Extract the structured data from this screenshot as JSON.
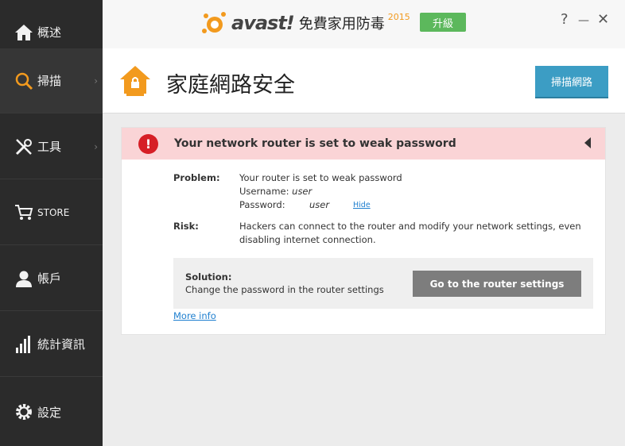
{
  "sidebar": {
    "items": [
      {
        "label": "概述",
        "icon": "home-icon"
      },
      {
        "label": "掃描",
        "icon": "search-icon"
      },
      {
        "label": "工具",
        "icon": "tools-icon"
      },
      {
        "label": "STORE",
        "icon": "cart-icon"
      },
      {
        "label": "帳戶",
        "icon": "user-icon"
      },
      {
        "label": "統計資訊",
        "icon": "stats-icon"
      },
      {
        "label": "設定",
        "icon": "gear-icon"
      }
    ],
    "active_index": 1
  },
  "header": {
    "brand": "avast!",
    "product_name": "免費家用防毒",
    "year": "2015",
    "upgrade_label": "升級",
    "help": "?",
    "minimize": "—",
    "close": "✕"
  },
  "page": {
    "title": "家庭網路安全",
    "scan_network_label": "掃描網路"
  },
  "alert": {
    "icon": "!",
    "message": "Your network router is set to weak password",
    "problem_label": "Problem:",
    "problem_text": "Your router is set to weak password",
    "username_label": "Username:",
    "username_value": "user",
    "password_label": "Password:",
    "password_value": "user",
    "hide_label": "Hide",
    "risk_label": "Risk:",
    "risk_line1": "Hackers can connect to the router and modify your network settings, even",
    "risk_line2": "disabling internet connection.",
    "solution_label": "Solution:",
    "solution_text": "Change the password in the router settings",
    "solution_button": "Go to the router settings",
    "more_info": "More info"
  },
  "colors": {
    "sidebar_bg": "#2b2b2b",
    "accent_orange": "#f29a1e",
    "upgrade_green": "#5cb85c",
    "scan_blue": "#3c9dc4",
    "alert_bg": "#fad4d6",
    "alert_red": "#d61f26",
    "link_blue": "#1f7fcf"
  }
}
